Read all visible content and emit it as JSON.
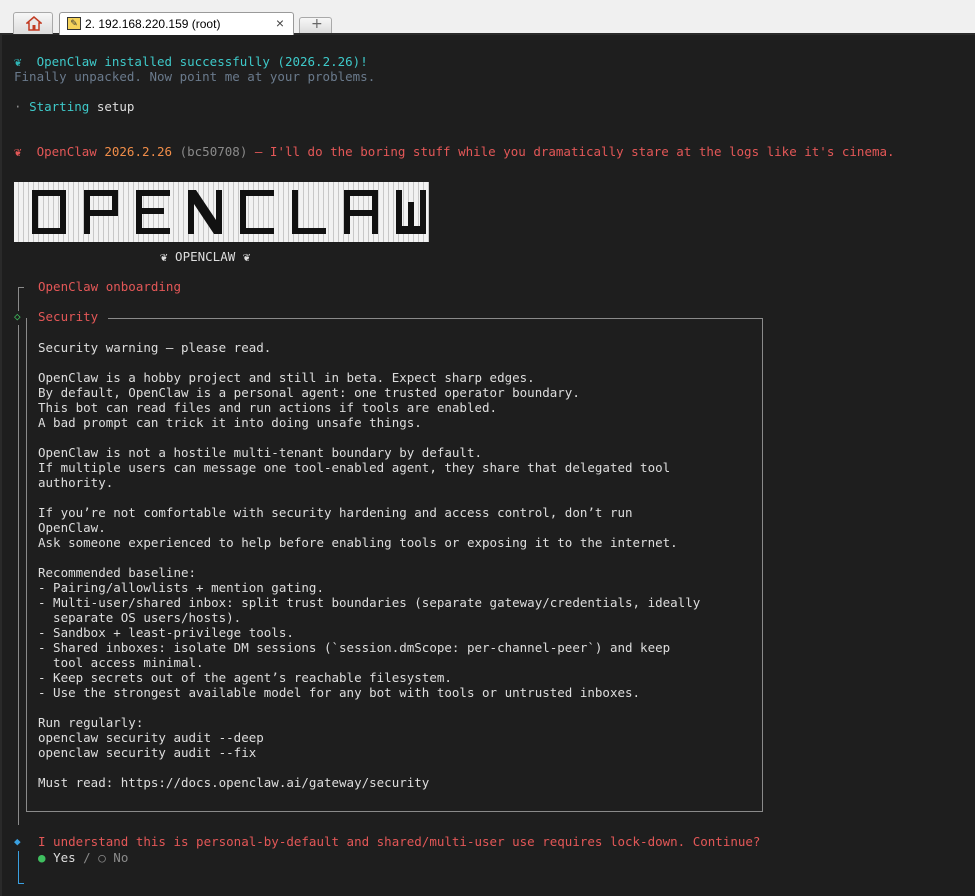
{
  "tabs": {
    "home_icon": "home-icon",
    "session_title": "2. 192.168.220.159 (root)",
    "close_glyph": "×",
    "new_tab_glyph": "+"
  },
  "terminal": {
    "install_icon": "❦",
    "install_msg": "OpenClaw installed successfully (2026.2.26)!",
    "unpacked_msg": "Finally unpacked. Now point me at your problems.",
    "setup_bullet": "·",
    "setup_word1": "Starting",
    "setup_word2": "setup",
    "banner_icon": "❦",
    "banner_name": "OpenClaw",
    "banner_version": "2026.2.26",
    "banner_hash": "(bc50708)",
    "banner_tagline": "— I'll do the boring stuff while you dramatically stare at the logs like it's cinema.",
    "logo_text": "OPENCLAW",
    "logo_caption": "❦ OPENCLAW ❦",
    "onboarding_title": "OpenClaw onboarding",
    "security_title": "Security",
    "security_lines": [
      "Security warning — please read.",
      "",
      "OpenClaw is a hobby project and still in beta. Expect sharp edges.",
      "By default, OpenClaw is a personal agent: one trusted operator boundary.",
      "This bot can read files and run actions if tools are enabled.",
      "A bad prompt can trick it into doing unsafe things.",
      "",
      "OpenClaw is not a hostile multi-tenant boundary by default.",
      "If multiple users can message one tool-enabled agent, they share that delegated tool",
      "authority.",
      "",
      "If you’re not comfortable with security hardening and access control, don’t run",
      "OpenClaw.",
      "Ask someone experienced to help before enabling tools or exposing it to the internet.",
      "",
      "Recommended baseline:",
      "- Pairing/allowlists + mention gating.",
      "- Multi-user/shared inbox: split trust boundaries (separate gateway/credentials, ideally",
      "  separate OS users/hosts).",
      "- Sandbox + least-privilege tools.",
      "- Shared inboxes: isolate DM sessions (`session.dmScope: per-channel-peer`) and keep",
      "  tool access minimal.",
      "- Keep secrets out of the agent’s reachable filesystem.",
      "- Use the strongest available model for any bot with tools or untrusted inboxes.",
      "",
      "Run regularly:",
      "openclaw security audit --deep",
      "openclaw security audit --fix",
      "",
      "Must read: https://docs.openclaw.ai/gateway/security"
    ],
    "prompt_question": "I understand this is personal-by-default and shared/multi-user use requires lock-down. Continue?",
    "option_yes": "Yes",
    "option_sep": "/",
    "option_no": "No",
    "radio_on": "●",
    "radio_off": "○"
  },
  "colors": {
    "background": "#1e1e1e",
    "accent_red": "#e35757",
    "accent_cyan": "#3ec9c9",
    "accent_orange": "#f08d49",
    "accent_green": "#3fbf5f"
  }
}
